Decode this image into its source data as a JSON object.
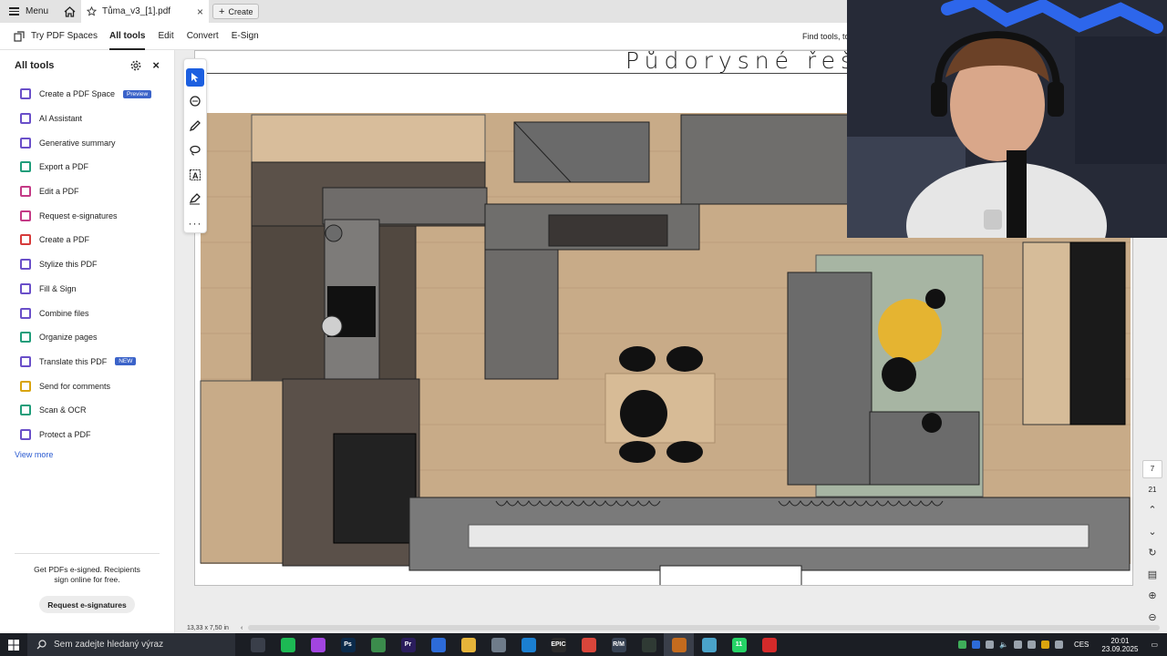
{
  "titlebar": {
    "menu_label": "Menu",
    "tab_title": "Tůma_v3_[1].pdf",
    "create_label": "Create"
  },
  "menubar": {
    "spaces_label": "Try PDF Spaces",
    "items": [
      "All tools",
      "Edit",
      "Convert",
      "E-Sign"
    ],
    "find_tools": "Find tools, top"
  },
  "sidebar": {
    "title": "All tools",
    "tools": [
      {
        "label": "Create a PDF Space",
        "badge": "Preview",
        "icon": "pdf-space-icon",
        "color": "#6a4fc9"
      },
      {
        "label": "AI Assistant",
        "badge": "",
        "icon": "ai-assistant-icon",
        "color": "#6a4fc9"
      },
      {
        "label": "Generative summary",
        "badge": "",
        "icon": "summary-icon",
        "color": "#6a4fc9"
      },
      {
        "label": "Export a PDF",
        "badge": "",
        "icon": "export-icon",
        "color": "#1f9d7a"
      },
      {
        "label": "Edit a PDF",
        "badge": "",
        "icon": "edit-icon",
        "color": "#c43a86"
      },
      {
        "label": "Request e-signatures",
        "badge": "",
        "icon": "esign-icon",
        "color": "#c43a86"
      },
      {
        "label": "Create a PDF",
        "badge": "",
        "icon": "create-pdf-icon",
        "color": "#d63b3b"
      },
      {
        "label": "Stylize this PDF",
        "badge": "",
        "icon": "stylize-icon",
        "color": "#6a4fc9"
      },
      {
        "label": "Fill & Sign",
        "badge": "",
        "icon": "fill-sign-icon",
        "color": "#6a4fc9"
      },
      {
        "label": "Combine files",
        "badge": "",
        "icon": "combine-icon",
        "color": "#6a4fc9"
      },
      {
        "label": "Organize pages",
        "badge": "",
        "icon": "organize-icon",
        "color": "#1f9d7a"
      },
      {
        "label": "Translate this PDF",
        "badge": "NEW",
        "icon": "translate-icon",
        "color": "#6a4fc9"
      },
      {
        "label": "Send for comments",
        "badge": "",
        "icon": "comments-icon",
        "color": "#d9a40f"
      },
      {
        "label": "Scan & OCR",
        "badge": "",
        "icon": "scan-icon",
        "color": "#1f9d7a"
      },
      {
        "label": "Protect a PDF",
        "badge": "",
        "icon": "protect-icon",
        "color": "#6a4fc9"
      }
    ],
    "view_more": "View more",
    "promo": "Get PDFs e-signed. Recipients sign online for free.",
    "cta": "Request e-signatures"
  },
  "document": {
    "heading": "Půdorysné řeše",
    "dimensions": "13,33 x 7,50 in"
  },
  "pagination": {
    "current": "7",
    "total": "21"
  },
  "taskbar": {
    "search_placeholder": "Sem zadejte hledaný výraz",
    "apps": [
      {
        "name": "task-view",
        "label": "",
        "color": "#3a3f4a"
      },
      {
        "name": "spotify",
        "label": "",
        "color": "#1db954"
      },
      {
        "name": "messenger",
        "label": "",
        "color": "#a245e0"
      },
      {
        "name": "photoshop",
        "label": "Ps",
        "color": "#0b2a4a"
      },
      {
        "name": "map-app",
        "label": "",
        "color": "#3b8c4c"
      },
      {
        "name": "premiere",
        "label": "Pr",
        "color": "#2a1d5c"
      },
      {
        "name": "store",
        "label": "",
        "color": "#2d6bd8"
      },
      {
        "name": "file-explorer",
        "label": "",
        "color": "#e6b43a"
      },
      {
        "name": "app-generic",
        "label": "",
        "color": "#6f7c8a"
      },
      {
        "name": "edge",
        "label": "",
        "color": "#1b7fd1"
      },
      {
        "name": "epic-games",
        "label": "EPIC",
        "color": "#2a2a2a"
      },
      {
        "name": "chrome",
        "label": "",
        "color": "#d9463b"
      },
      {
        "name": "app-rm",
        "label": "R/M",
        "color": "#364152"
      },
      {
        "name": "app-dark",
        "label": "",
        "color": "#2f3a34"
      },
      {
        "name": "terminal",
        "label": "",
        "color": "#c46b1e"
      },
      {
        "name": "notes",
        "label": "",
        "color": "#4aa3c9"
      },
      {
        "name": "whatsapp",
        "label": "11",
        "color": "#25d366"
      },
      {
        "name": "acrobat",
        "label": "",
        "color": "#d42a2a"
      }
    ],
    "language": "CES",
    "time": "20:01",
    "date": "23.09.2025"
  }
}
